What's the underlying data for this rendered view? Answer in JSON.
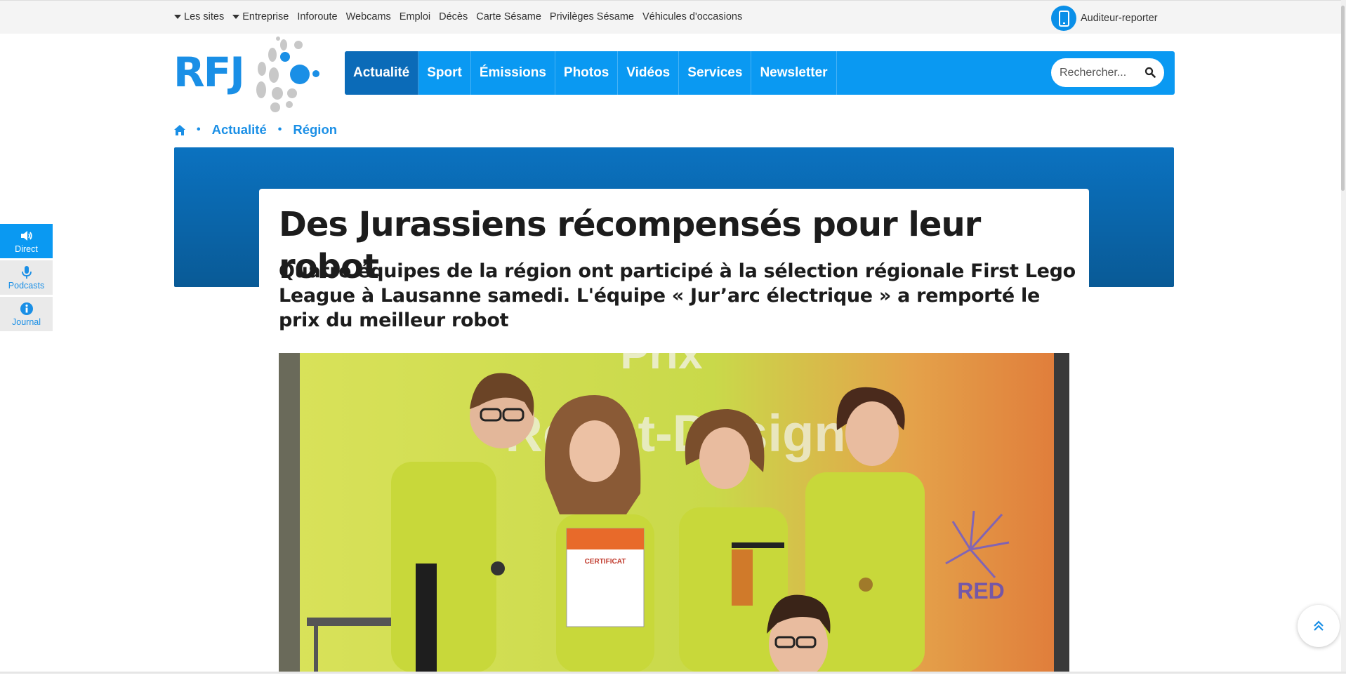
{
  "topbar": {
    "links": [
      {
        "label": "Les sites",
        "dropdown": true
      },
      {
        "label": "Entreprise",
        "dropdown": true
      },
      {
        "label": "Inforoute",
        "dropdown": false
      },
      {
        "label": "Webcams",
        "dropdown": false
      },
      {
        "label": "Emploi",
        "dropdown": false
      },
      {
        "label": "Décès",
        "dropdown": false
      },
      {
        "label": "Carte Sésame",
        "dropdown": false
      },
      {
        "label": "Privilèges Sésame",
        "dropdown": false
      },
      {
        "label": "Véhicules d'occasions",
        "dropdown": false
      }
    ],
    "reporter_label": "Auditeur-reporter",
    "reporter_icon": "mobile-phone-icon"
  },
  "logo": {
    "text": "RFJ"
  },
  "nav": {
    "items": [
      {
        "label": "Actualité",
        "active": true
      },
      {
        "label": "Sport",
        "active": false
      },
      {
        "label": "Émissions",
        "active": false
      },
      {
        "label": "Photos",
        "active": false
      },
      {
        "label": "Vidéos",
        "active": false
      },
      {
        "label": "Services",
        "active": false
      },
      {
        "label": "Newsletter",
        "active": false
      }
    ],
    "search_placeholder": "Rechercher...",
    "search_icon": "search-icon"
  },
  "breadcrumb": {
    "home_icon": "home-icon",
    "separator": "•",
    "items": [
      "Actualité",
      "Région"
    ]
  },
  "article": {
    "title": "Des Jurassiens récompensés pour leur robot",
    "lead": "Quatre équipes de la région ont participé à la sélection régionale First Lego League à Lausanne samedi. L'équipe « Jur’arc électrique » a remporté le prix du meilleur robot",
    "photo_text": [
      "Prix",
      "Robot-Design"
    ],
    "certificate_text": "CERTIFICAT"
  },
  "dock": {
    "items": [
      {
        "label": "Direct",
        "icon": "speaker-icon",
        "active": true
      },
      {
        "label": "Podcasts",
        "icon": "microphone-icon",
        "active": false
      },
      {
        "label": "Journal",
        "icon": "info-icon",
        "active": false
      }
    ]
  },
  "back_to_top_icon": "double-chevron-up-icon",
  "colors": {
    "brand_blue": "#0a99f2",
    "active_nav": "#0b6bb8",
    "hero_band": "#0b72c0",
    "text_dark": "#1c1c1c",
    "link_blue": "#1a8fe6"
  }
}
